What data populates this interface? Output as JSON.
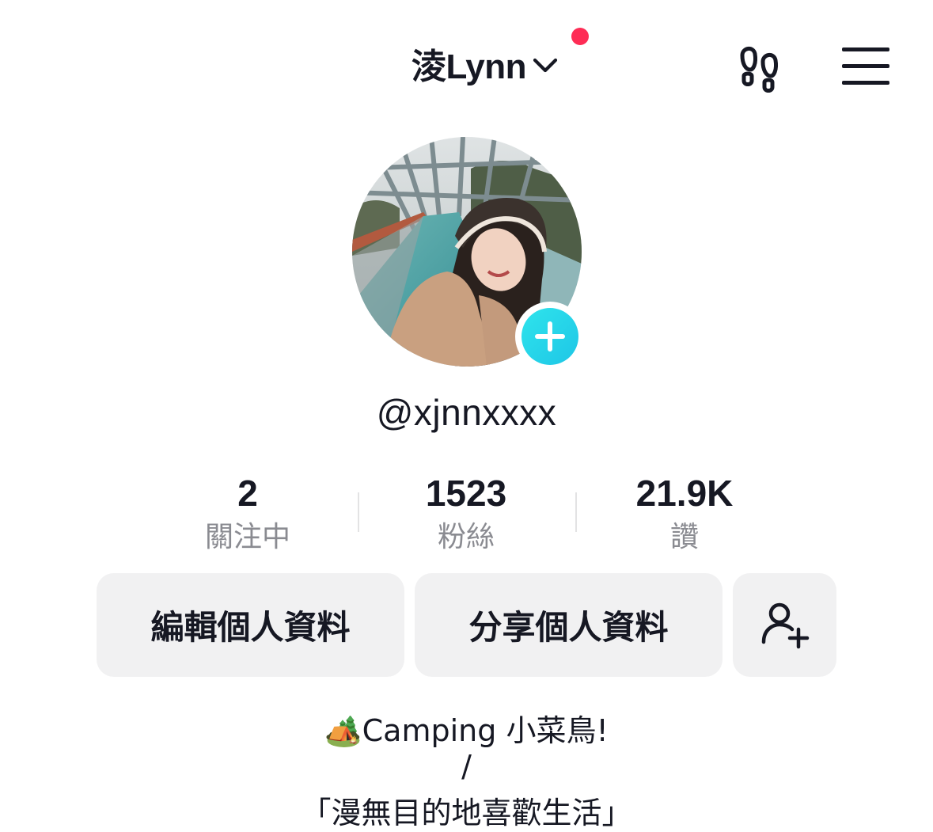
{
  "header": {
    "username": "淩Lynn",
    "icons": [
      "chevron-down-icon",
      "notification-dot",
      "footprints-icon",
      "hamburger-menu-icon"
    ],
    "accent": "#fe2c55"
  },
  "profile": {
    "handle": "@xjnnxxxx",
    "avatar": "profile-photo",
    "badge_color": "#20d5ec"
  },
  "stats": [
    {
      "value": "2",
      "label": "關注中"
    },
    {
      "value": "1523",
      "label": "粉絲"
    },
    {
      "value": "21.9K",
      "label": "讚"
    }
  ],
  "actions": {
    "edit_label": "編輯個人資料",
    "share_label": "分享個人資料",
    "add_friend_icon": "add-friend-icon"
  },
  "bio": {
    "line1_emoji": "🏕️",
    "line1_text": "Camping 小菜鳥!",
    "line2": "/",
    "line3": "「漫無目的地喜歡生活」"
  }
}
